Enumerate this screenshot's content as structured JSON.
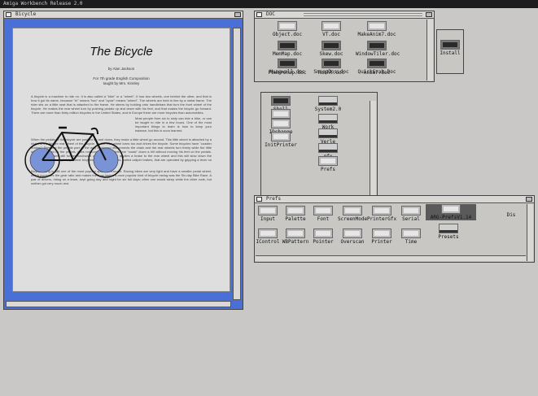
{
  "screen": {
    "title": "Amiga Workbench  Release 2.0"
  },
  "document": {
    "window_title": "Bicycle",
    "heading": "The Bicycle",
    "author": "by Alan Jackson",
    "course": "For 7th grade English Composition",
    "teacher": "taught by Mrs. Kinnley",
    "para1": "A bicycle is a machine to ride on. It is also called a \"bike\" or a \"wheel\". It has two wheels, one behind the other, and that is how it got its name, because \"bi\" means \"two\" and \"cycle\" means \"wheel\". The wheels are held in line by a metal frame. The rider sits on a little seat that is attached to the frame. He steers by holding onto handlebars that turn the front wheel of the bicycle. He makes the rear wheel turn by pushing pedals up and down with his feet, and that makes the bicycle go forward. There are more than thirty million bicycles in the United States, and in Europe there are more bicycles than automobiles.",
    "para2": "Most people from six to sixty can ride a bike, or can be taught to ride in a few hours. One of the most important things to learn is how to keep your balance, but this is soon learned.",
    "para3": "When the pedals of the bicycle are pushed up and down, they make a little wheel go around. This little wheel is attached by a chain to the bigger rear wheel of the bicycle, so the rear wheel turns too and drives the bicycle. Some bicycles have \"coaster brakes\". Pressing the pedals part of the way backward disconnects the chain and the rear wheels turn freely while the little wheel, operated by the pedals, does not turn at all. This lets one \"coast\" down a hill without moving his feet on the pedals. Then if he presses still further backward on the pedals he applies a brake to the rear wheel and this will slow down the bicycle or stop it completely. Some bicycles have other brakes, called caliper brakes, that are operated by gripping a lever on the handlebars.",
    "para4": "Bicycle riding is still one of the most popular sports in Europe. Racing bikes are very light and have a smaller pedal wheel, which increases the gear ratio and makes them go faster. A once popular kind of bicycle racing was the Six-day Bike Race. A pair of drivers, riding on a team, kept going day and night for six full days; often one would sleep while the other rode, but neither got very much rest."
  },
  "disk": {
    "window_title": "DOC",
    "icons": [
      "Object.doc",
      "VT.doc",
      "MakeAnim7.doc",
      "MemMap.doc",
      "Skew.doc",
      "WindowTiler.doc",
      "Mungwall.doc",
      "SnoopDos.doc",
      "QuickGrab.Doc",
      "Powersnap.doc",
      "Rushl.doc",
      "Anim7.doc"
    ]
  },
  "system": {
    "icons": [
      "Shell",
      "System2.0",
      "Ed",
      "CX",
      "IDchange",
      "Work",
      "InitPrinter",
      "Verle",
      "gfx",
      "Prefs"
    ]
  },
  "install": {
    "label": "Install"
  },
  "prefs": {
    "window_title": "Prefs",
    "icons": [
      "Input",
      "Palette",
      "Font",
      "ScreenMode",
      "PrinterGfx",
      "Serial",
      "ARG-Prefs",
      "IControl",
      "WBPattern",
      "Pointer",
      "Overscan",
      "Printer",
      "Time",
      "Presets"
    ],
    "selected_label": "ARG-PrefsV1.14",
    "edge_label": "Dis"
  }
}
